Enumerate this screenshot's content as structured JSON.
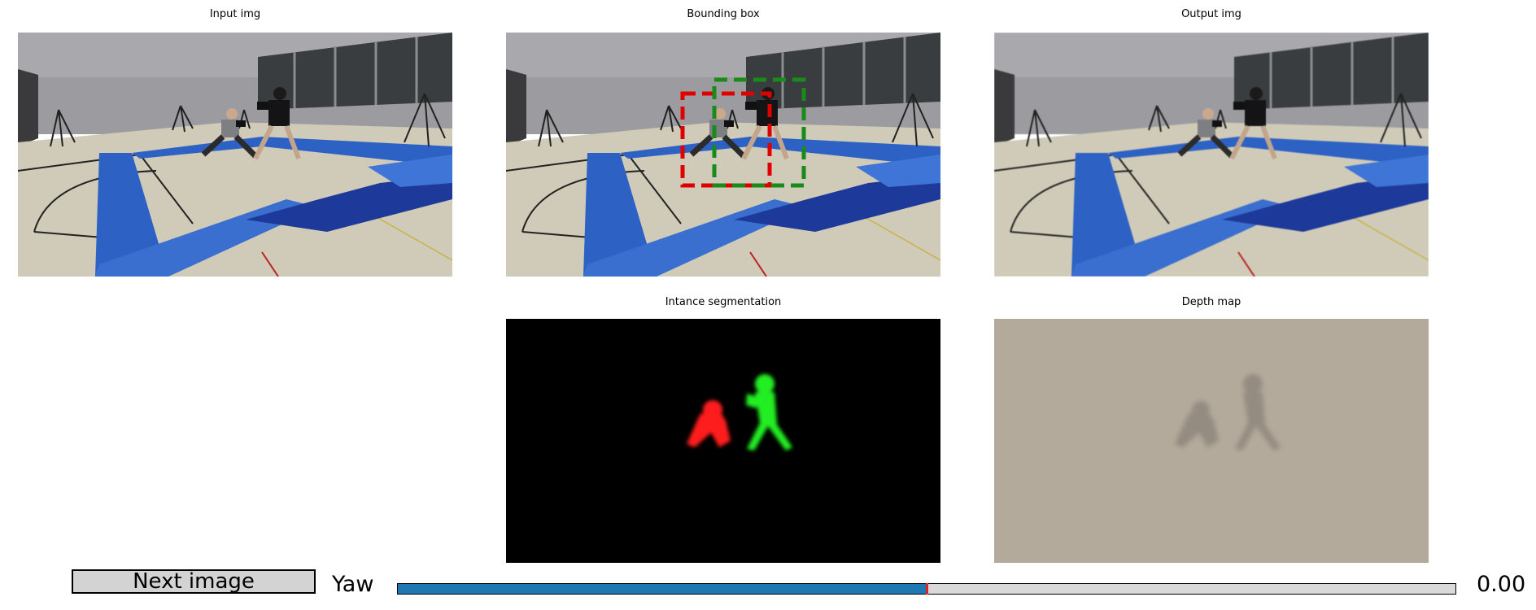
{
  "panels": {
    "input": {
      "title": "Input img"
    },
    "bbox": {
      "title": "Bounding box"
    },
    "output": {
      "title": "Output img"
    },
    "segmentation": {
      "title": "Intance segmentation"
    },
    "depth": {
      "title": "Depth map"
    }
  },
  "controls": {
    "next_button_label": "Next image",
    "slider_label": "Yaw",
    "slider_value_text": "0.00",
    "slider_fraction": 0.5
  },
  "colors": {
    "slider_fill": "#1f77b4",
    "slider_marker": "#d62728",
    "box_red": "#e00000",
    "box_green": "#1a8a1a",
    "seg_red": "#ff1a1a",
    "seg_green": "#22ee22",
    "depth_bg": "#b3aa9b"
  }
}
